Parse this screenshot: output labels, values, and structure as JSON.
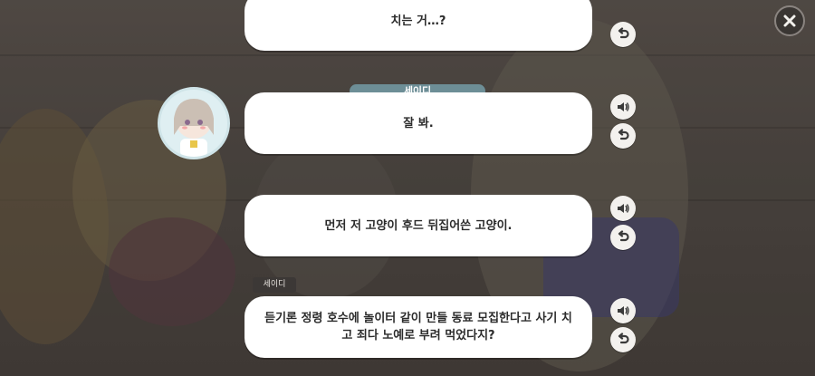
{
  "colors": {
    "bubble_bg": "#ffffff",
    "name_plate": "#6d8e96",
    "text": "#2b2b2b",
    "dim_overlay": "#4a4441"
  },
  "log": {
    "entries": [
      {
        "text": "치는 거…?"
      },
      {
        "speaker": "세이디",
        "text": "잘 봐."
      },
      {
        "text": "먼저 저 고양이 후드 뒤집어쓴 고양이."
      },
      {
        "speaker": "세이디",
        "text": "듣기론 정령 호수에 놀이터 같이 만들 동료 모집한다고 사기 치고 죄다 노예로 부려 먹었다지?"
      }
    ]
  },
  "icons": {
    "close": "close-icon",
    "replay": "replay-voice-icon",
    "voice": "voice-speaker-icon"
  }
}
